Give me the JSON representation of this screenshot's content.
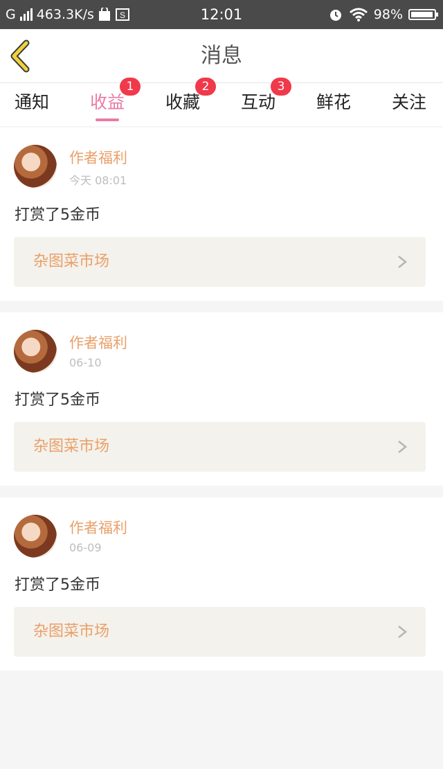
{
  "status_bar": {
    "network": "G",
    "speed": "463.3K/s",
    "time": "12:01",
    "battery": "98%",
    "battery_level": 0.98
  },
  "nav": {
    "title": "消息"
  },
  "tabs": [
    {
      "label": "通知",
      "badge": ""
    },
    {
      "label": "收益",
      "badge": "1"
    },
    {
      "label": "收藏",
      "badge": "2"
    },
    {
      "label": "互动",
      "badge": "3"
    },
    {
      "label": "鲜花",
      "badge": ""
    },
    {
      "label": "关注",
      "badge": ""
    }
  ],
  "active_tab": 1,
  "messages": [
    {
      "author": "作者福利",
      "date": "今天 08:01",
      "text": "打赏了5金币",
      "link": "杂图菜市场"
    },
    {
      "author": "作者福利",
      "date": "06-10",
      "text": "打赏了5金币",
      "link": "杂图菜市场"
    },
    {
      "author": "作者福利",
      "date": "06-09",
      "text": "打赏了5金币",
      "link": "杂图菜市场"
    }
  ],
  "colors": {
    "accent": "#e87ba4",
    "badge": "#f0394a",
    "author": "#e9a06a",
    "back_arrow": "#f0d23c"
  }
}
